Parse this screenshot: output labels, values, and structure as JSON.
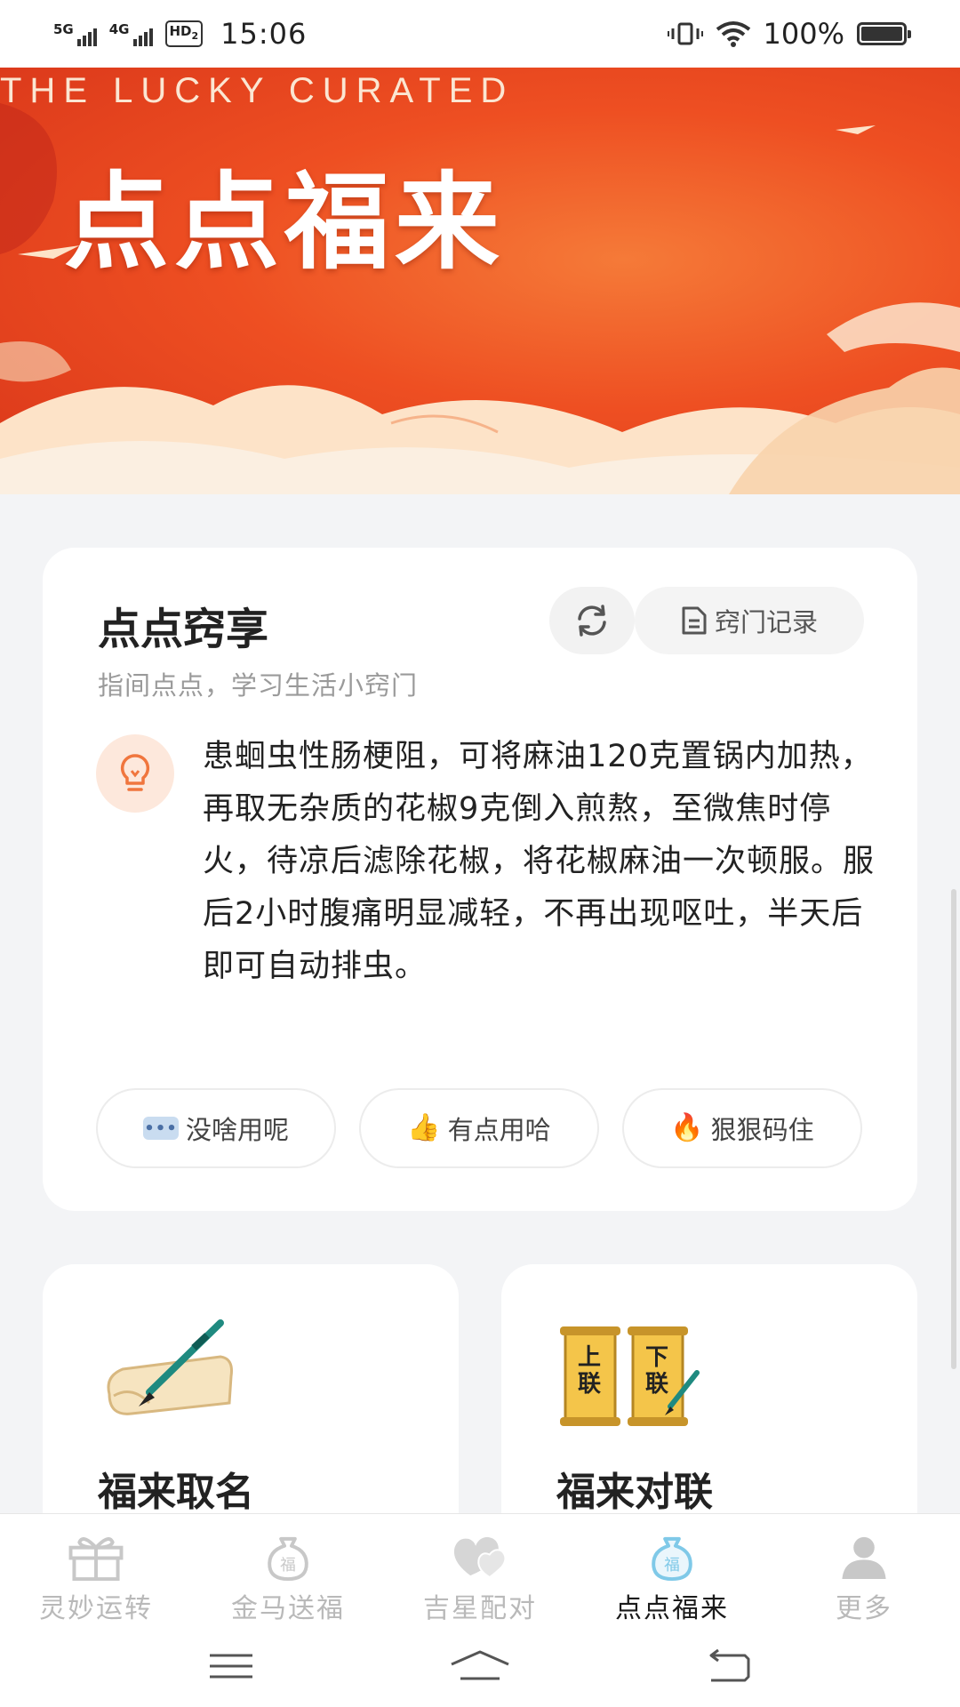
{
  "status_bar": {
    "network1": "5G",
    "network2": "4G",
    "hd_label": "HD",
    "hd_sub": "2",
    "time": "15:06",
    "battery": "100%"
  },
  "banner": {
    "tagline": "THE LUCKY CURATED",
    "title": "点点福来"
  },
  "tip_card": {
    "title": "点点窍享",
    "subtitle": "指间点点，学习生活小窍门",
    "record_label": "窍门记录",
    "text": "患蛔虫性肠梗阻，可将麻油120克置锅内加热，再取无杂质的花椒9克倒入煎熬，至微焦时停火，待凉后滤除花椒，将花椒麻油一次顿服。服后2小时腹痛明显减轻，不再出现呕吐，半天后即可自动排虫。",
    "reactions": [
      {
        "label": "没啥用呢",
        "icon": "speech-bubble-icon"
      },
      {
        "label": "有点用哈",
        "icon": "thumbs-up-icon",
        "emoji": "👍"
      },
      {
        "label": "狠狠码住",
        "icon": "fire-icon",
        "emoji": "🔥"
      }
    ]
  },
  "features": [
    {
      "title": "福来取名",
      "icon": "scroll-brush-icon"
    },
    {
      "title": "福来对联",
      "icon": "couplet-scrolls-icon",
      "scroll_top": "上联",
      "scroll_bottom": "下联"
    }
  ],
  "bottom_nav": {
    "items": [
      {
        "label": "灵妙运转",
        "icon": "gift-icon",
        "active": false
      },
      {
        "label": "金马送福",
        "icon": "fortune-bag-icon",
        "active": false
      },
      {
        "label": "吉星配对",
        "icon": "hearts-icon",
        "active": false
      },
      {
        "label": "点点福来",
        "icon": "fortune-bag-icon",
        "active": true
      },
      {
        "label": "更多",
        "icon": "person-icon",
        "active": false
      }
    ],
    "fu_char": "福"
  },
  "colors": {
    "accent": "#ee4f22",
    "active_icon": "#7fc9e8",
    "inactive": "#b9b9b9"
  }
}
